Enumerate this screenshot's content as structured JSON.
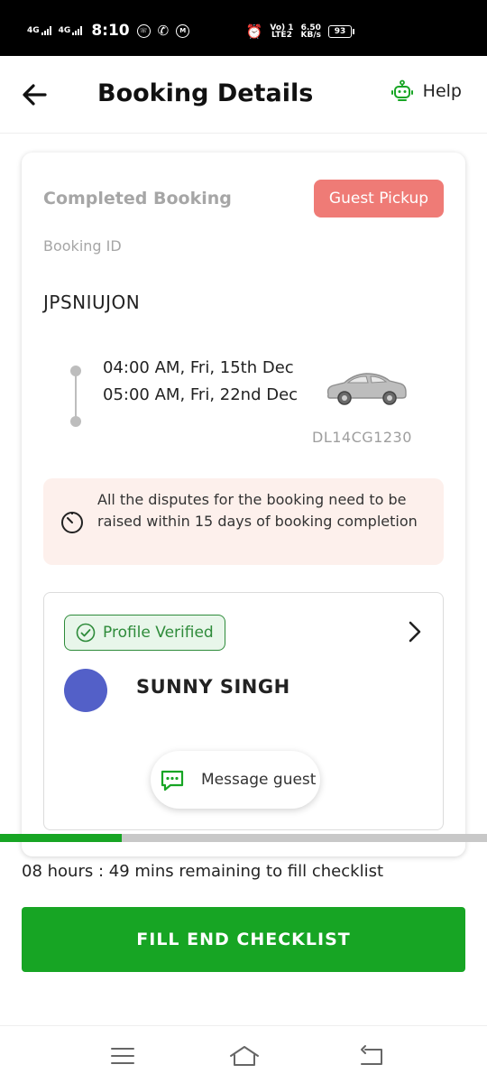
{
  "status_bar": {
    "net1": "4G",
    "net2": "4G",
    "time": "8:10",
    "volte_top": "Vo) 1",
    "volte_bottom": "LTE2",
    "speed_top": "6.50",
    "speed_bottom": "KB/s",
    "battery": "93"
  },
  "header": {
    "title": "Booking Details",
    "help_label": "Help"
  },
  "booking": {
    "status": "Completed Booking",
    "pickup_badge": "Guest Pickup",
    "id_label": "Booking ID",
    "id_value": "JPSNIUJON",
    "start": "04:00 AM, Fri, 15th Dec",
    "end": "05:00 AM, Fri, 22nd Dec",
    "plate": "DL14CG1230"
  },
  "dispute": {
    "text": "All the disputes for the booking need to be raised within 15 days of booking completion"
  },
  "guest": {
    "verified_label": "Profile Verified",
    "name": "SUNNY SINGH",
    "avatar_color": "#5360c8",
    "message_label": "Message guest"
  },
  "checklist": {
    "progress": 0.25,
    "remaining_text": "08 hours : 49 mins remaining to fill checklist",
    "button_label": "FILL END CHECKLIST"
  },
  "colors": {
    "primary_green": "#17a524",
    "badge_red": "#ef7b76",
    "dispute_bg": "#fdf0ec"
  }
}
